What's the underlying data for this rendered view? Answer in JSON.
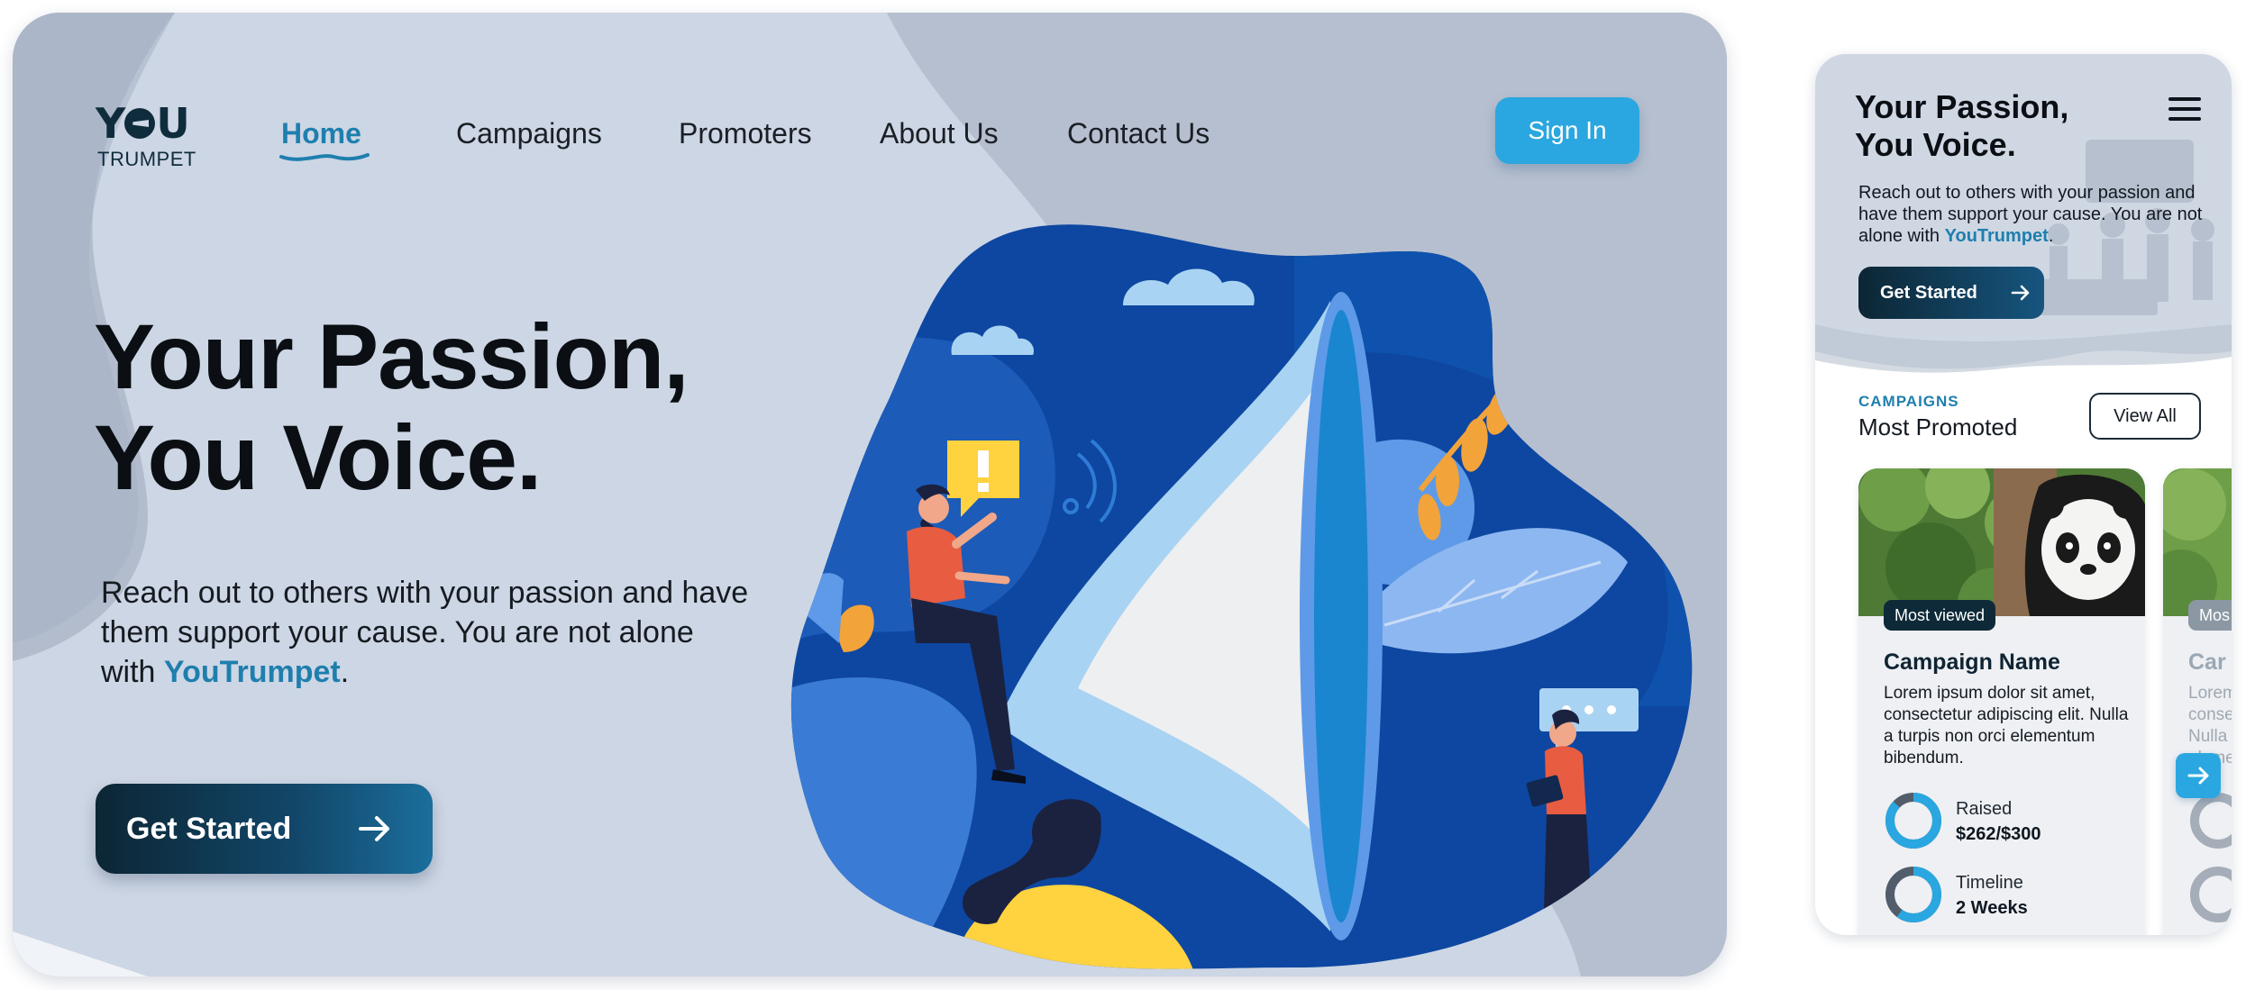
{
  "desktop": {
    "logo": {
      "word": "Y",
      "word_end": "U",
      "sub": "TRUMPET"
    },
    "nav": [
      {
        "label": "Home",
        "active": true
      },
      {
        "label": "Campaigns"
      },
      {
        "label": "Promoters"
      },
      {
        "label": "About Us"
      },
      {
        "label": "Contact Us"
      }
    ],
    "signin_label": "Sign In",
    "hero": {
      "title_line1": "Your Passion,",
      "title_line2": "You Voice.",
      "desc_before": "Reach out to others with your passion and have them support your cause. You are not alone with ",
      "desc_brand": "YouTrumpet",
      "desc_after": "."
    },
    "cta_label": "Get Started",
    "illustration_icon": "megaphone-illustration"
  },
  "mobile": {
    "title_line1": "Your Passion,",
    "title_line2": "You Voice.",
    "desc_before": "Reach out to others with your passion and have them support your cause. You are not alone with ",
    "desc_brand": "YouTrumpet",
    "desc_after": ".",
    "cta_label": "Get Started",
    "section": {
      "kicker": "CAMPAIGNS",
      "title": "Most Promoted",
      "view_all": "View All"
    },
    "cards": [
      {
        "badge": "Most viewed",
        "title": "Campaign Name",
        "desc": "Lorem ipsum dolor sit amet, consectetur adipiscing elit. Nulla a turpis non orci elementum bibendum.",
        "raised_label": "Raised",
        "raised_value": "$262/$300",
        "raised_fraction": 0.87,
        "timeline_label": "Timeline",
        "timeline_value": "2 Weeks",
        "timeline_fraction": 0.6
      },
      {
        "badge": "Mos",
        "title": "Car",
        "desc": "Lorem conse Nulla eleme"
      }
    ]
  },
  "colors": {
    "accent": "#2aa7e0",
    "brand_text": "#1e7fae",
    "dark": "#0c2634",
    "bg": "#cdd6e4"
  }
}
